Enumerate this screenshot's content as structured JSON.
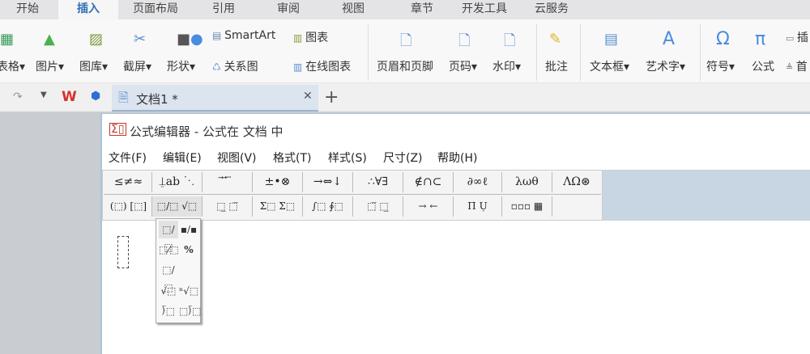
{
  "ribbon_tabs": [
    "开始",
    "插入",
    "页面布局",
    "引用",
    "审阅",
    "视图",
    "章节",
    "开发工具",
    "云服务"
  ],
  "active_tab": "插入",
  "ribbon": {
    "table": "表格",
    "picture": "图片",
    "gallery": "图库",
    "screenshot": "截屏",
    "shape": "形状",
    "smartart": "SmartArt",
    "chart": "图表",
    "relation": "关系图",
    "online_chart": "在线图表",
    "header_footer": "页眉和页脚",
    "page_number": "页码",
    "watermark": "水印",
    "comment": "批注",
    "textbox": "文本框",
    "wordart": "艺术字",
    "symbol": "符号",
    "formula": "公式",
    "insert_more": "插",
    "first_letter": "首"
  },
  "doc_tab": {
    "title": "文档1 *"
  },
  "editor": {
    "title": "公式编辑器 - 公式在 文档 中",
    "menus": [
      "文件(F)",
      "编辑(E)",
      "视图(V)",
      "格式(T)",
      "样式(S)",
      "尺寸(Z)",
      "帮助(H)"
    ],
    "row1": [
      "≤≠≈",
      "⍊ab ⋱",
      "⃗ ⃗ ⃛",
      "±•⊗",
      "→⇔↓",
      "∴∀∃",
      "∉∩⊂",
      "∂∞ℓ",
      "λωθ",
      "ΛΩ⊛"
    ],
    "row2": [
      "(⬚) [⬚]",
      "⬚/⬚ √⬚",
      "⬚̲ ⬚̅",
      "Σ⬚ Σ⬚",
      "∫⬚ ∮⬚",
      "⬚̅ ⬚̲",
      "→ ←",
      "Π̇ Ụ",
      "▫▫▫ ▦"
    ],
    "popup": [
      "⬚/⬚",
      "▪/▪",
      "⬚⁄⬚",
      "%",
      "⬚/⬚",
      "√⬚",
      "ⁿ√⬚",
      "⟌⬚",
      "⬚⟌⬚"
    ]
  },
  "colors": {
    "accent": "#2f6fb9",
    "toolbar_bg": "#c8d5e2"
  }
}
